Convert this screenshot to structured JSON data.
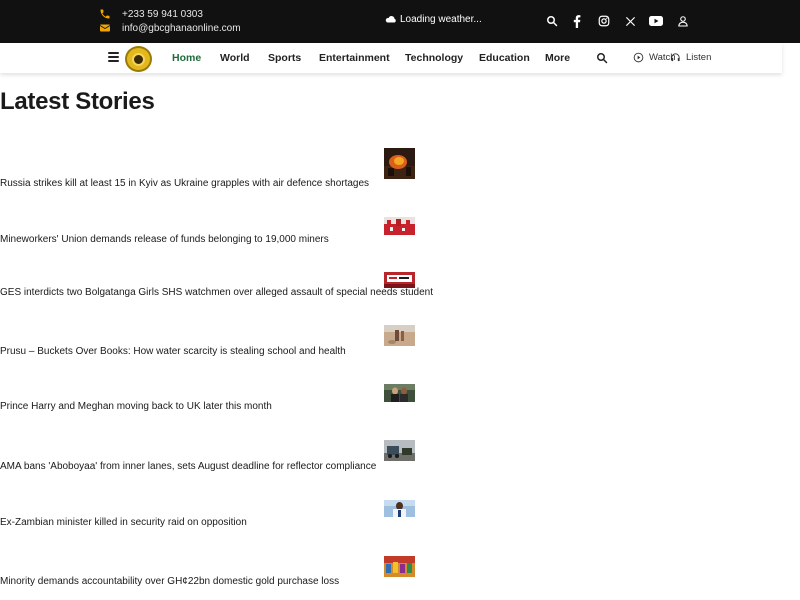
{
  "topbar": {
    "phone": "+233 59 941 0303",
    "email": "info@gbcghanaonline.com",
    "weather": "Loading weather...",
    "phone_icon": "phone-icon",
    "mail_icon": "envelope-icon",
    "weather_icon": "cloud-icon",
    "social_icons": [
      "search-icon",
      "facebook-icon",
      "instagram-icon",
      "x-icon",
      "youtube-icon",
      "user-icon"
    ],
    "accent": "#f0a500",
    "background": "#111111"
  },
  "nav": {
    "items": [
      "Home",
      "World",
      "Sports",
      "Entertainment",
      "Technology",
      "Education",
      "More"
    ],
    "active": "Home",
    "active_color": "#1f6b3a",
    "watch": "Watch",
    "listen": "Listen",
    "watch_icon": "play-circle-icon",
    "listen_icon": "headphones-icon",
    "search_icon": "search-icon",
    "menu_icon": "hamburger-icon",
    "logo": "gbc-logo"
  },
  "main": {
    "title": "Latest Stories",
    "stories": [
      {
        "headline": "Russia strikes kill at least 15 in Kyiv as Ukraine grapples with air defence shortages",
        "thumb": "fire-night"
      },
      {
        "headline": "Mineworkers' Union demands release of funds belonging to 19,000 miners",
        "thumb": "red-crowd"
      },
      {
        "headline": "GES interdicts two Bolgatanga Girls SHS watchmen over alleged assault of special needs student",
        "thumb": "red-sign"
      },
      {
        "headline": "Prusu – Buckets Over Books: How water scarcity is stealing school and health",
        "thumb": "dry-field"
      },
      {
        "headline": "Prince Harry and Meghan moving back to UK later this month",
        "thumb": "couple"
      },
      {
        "headline": "AMA bans 'Aboboyaa' from inner lanes, sets August deadline for reflector compliance",
        "thumb": "street"
      },
      {
        "headline": "Ex-Zambian minister killed in security raid on opposition",
        "thumb": "portrait"
      },
      {
        "headline": "Minority demands accountability over GH¢22bn domestic gold purchase loss",
        "thumb": "colorful-crowd"
      }
    ]
  }
}
